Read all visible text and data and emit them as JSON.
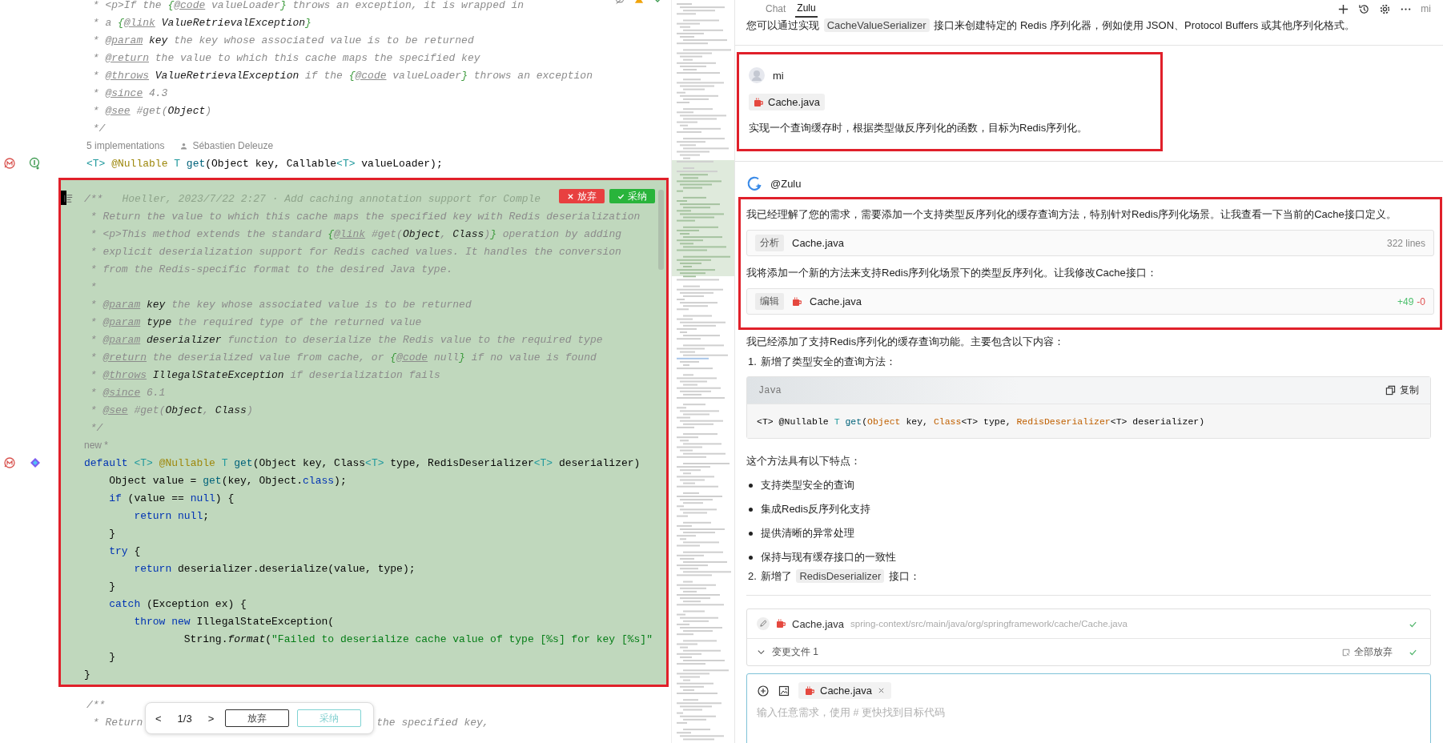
{
  "editor": {
    "top_lines": [
      {
        "kind": "code",
        "tokens": [
          {
            "kind": "comment",
            "text": " * <p>If the "
          },
          {
            "kind": "brace",
            "text": "{"
          },
          {
            "kind": "doctag",
            "text": "@code"
          },
          {
            "kind": "comment",
            "text": " valueLoader"
          },
          {
            "kind": "brace",
            "text": "}"
          },
          {
            "kind": "comment",
            "text": " throws an exception, it is wrapped in"
          }
        ]
      },
      {
        "kind": "code",
        "tokens": [
          {
            "kind": "comment",
            "text": " * a "
          },
          {
            "kind": "brace",
            "text": "{"
          },
          {
            "kind": "doctag",
            "text": "@link"
          },
          {
            "kind": "docref",
            "text": " ValueRetrievalException"
          },
          {
            "kind": "brace",
            "text": "}"
          }
        ]
      },
      {
        "kind": "code",
        "tokens": [
          {
            "kind": "comment",
            "text": " * "
          },
          {
            "kind": "doctag",
            "text": "@param"
          },
          {
            "kind": "docref",
            "text": " key"
          },
          {
            "kind": "comment",
            "text": " the key whose associated value is to be returned"
          }
        ]
      },
      {
        "kind": "code",
        "tokens": [
          {
            "kind": "comment",
            "text": " * "
          },
          {
            "kind": "doctag",
            "text": "@return"
          },
          {
            "kind": "comment",
            "text": " the value to which this cache maps the specified key"
          }
        ]
      },
      {
        "kind": "code",
        "tokens": [
          {
            "kind": "comment",
            "text": " * "
          },
          {
            "kind": "doctag",
            "text": "@throws"
          },
          {
            "kind": "docref",
            "text": " ValueRetrievalException"
          },
          {
            "kind": "comment",
            "text": " if the "
          },
          {
            "kind": "brace",
            "text": "{"
          },
          {
            "kind": "doctag",
            "text": "@code"
          },
          {
            "kind": "comment",
            "text": " valueLoader"
          },
          {
            "kind": "brace",
            "text": "}"
          },
          {
            "kind": "comment",
            "text": " throws an exception"
          }
        ]
      },
      {
        "kind": "code",
        "tokens": [
          {
            "kind": "comment",
            "text": " * "
          },
          {
            "kind": "doctag",
            "text": "@since"
          },
          {
            "kind": "comment",
            "text": " 4.3"
          }
        ]
      },
      {
        "kind": "code",
        "tokens": [
          {
            "kind": "comment",
            "text": " * "
          },
          {
            "kind": "doctag",
            "text": "@see"
          },
          {
            "kind": "comment",
            "text": " #get("
          },
          {
            "kind": "docref",
            "text": "Object"
          },
          {
            "kind": "comment",
            "text": ")"
          }
        ]
      },
      {
        "kind": "code",
        "tokens": [
          {
            "kind": "comment",
            "text": " */"
          }
        ]
      },
      {
        "kind": "hint",
        "texts": [
          "5 implementations",
          "Sébastien Deleuze"
        ]
      },
      {
        "kind": "code",
        "tokens": [
          {
            "kind": "generic",
            "text": "<T> "
          },
          {
            "kind": "annotation",
            "text": "@Nullable "
          },
          {
            "kind": "generic",
            "text": "T "
          },
          {
            "kind": "method",
            "text": "get"
          },
          {
            "kind": "plain",
            "text": "(Object key, Callable"
          },
          {
            "kind": "generic",
            "text": "<T>"
          },
          {
            "kind": "plain",
            "text": " valueLoader);"
          }
        ]
      }
    ],
    "diff_block": {
      "highlighted": true,
      "discard": "放弃",
      "accept": "采纳",
      "lines": [
        {
          "kind": "code",
          "tokens": [
            {
              "kind": "comment",
              "text": "/**"
            }
          ],
          "blame": "Hoeller, 2023/7/22 2:27 · Add caching annotation support for Comple"
        },
        {
          "kind": "code",
          "tokens": [
            {
              "kind": "comment",
              "text": " * Return the value to which this cache maps the specified key with Redis deserialization"
            }
          ]
        },
        {
          "kind": "code",
          "tokens": [
            {
              "kind": "comment",
              "text": " * <p>This method extends the standard "
            },
            {
              "kind": "brace",
              "text": "{"
            },
            {
              "kind": "doctag",
              "text": "@link"
            },
            {
              "kind": "comment",
              "text": " #get("
            },
            {
              "kind": "docref",
              "text": "Object"
            },
            {
              "kind": "comment",
              "text": ", "
            },
            {
              "kind": "docref",
              "text": "Class"
            },
            {
              "kind": "comment",
              "text": ")"
            },
            {
              "kind": "brace",
              "text": "}"
            },
            {
              "kind": "comment",
              "text": " operation by adding"
            }
          ]
        },
        {
          "kind": "code",
          "tokens": [
            {
              "kind": "comment",
              "text": " * explicit deserialization support for Redis cached values. It handles the conversion"
            }
          ]
        },
        {
          "kind": "code",
          "tokens": [
            {
              "kind": "comment",
              "text": " * from the Redis-specific format to the desired Java type."
            }
          ]
        },
        {
          "kind": "code",
          "tokens": [
            {
              "kind": "comment",
              "text": " *"
            }
          ]
        },
        {
          "kind": "code",
          "tokens": [
            {
              "kind": "comment",
              "text": " * "
            },
            {
              "kind": "doctag",
              "text": "@param"
            },
            {
              "kind": "docref",
              "text": " key"
            },
            {
              "kind": "comment",
              "text": " the key whose associated value is to be returned"
            }
          ]
        },
        {
          "kind": "code",
          "tokens": [
            {
              "kind": "comment",
              "text": " * "
            },
            {
              "kind": "doctag",
              "text": "@param"
            },
            {
              "kind": "docref",
              "text": " type"
            },
            {
              "kind": "comment",
              "text": " the required type of the returned value"
            }
          ]
        },
        {
          "kind": "code",
          "tokens": [
            {
              "kind": "comment",
              "text": " * "
            },
            {
              "kind": "doctag",
              "text": "@param"
            },
            {
              "kind": "docref",
              "text": " deserializer"
            },
            {
              "kind": "comment",
              "text": " function to deserialize the Redis value to the required type"
            }
          ]
        },
        {
          "kind": "code",
          "tokens": [
            {
              "kind": "comment",
              "text": " * "
            },
            {
              "kind": "doctag",
              "text": "@return"
            },
            {
              "kind": "comment",
              "text": " the deserialized value from cache, or "
            },
            {
              "kind": "brace",
              "text": "{"
            },
            {
              "kind": "doctag",
              "text": "@code"
            },
            {
              "kind": "comment",
              "text": " null"
            },
            {
              "kind": "brace",
              "text": "}"
            },
            {
              "kind": "comment",
              "text": " if no value is found"
            }
          ]
        },
        {
          "kind": "code",
          "tokens": [
            {
              "kind": "comment",
              "text": " * "
            },
            {
              "kind": "doctag",
              "text": "@throws"
            },
            {
              "kind": "docref",
              "text": " IllegalStateException"
            },
            {
              "kind": "comment",
              "text": " if deserialization fails"
            }
          ]
        },
        {
          "kind": "code",
          "tokens": [
            {
              "kind": "comment",
              "text": " * "
            },
            {
              "kind": "doctag",
              "text": "@since"
            },
            {
              "kind": "comment",
              "text": " 6.1"
            }
          ]
        },
        {
          "kind": "code",
          "tokens": [
            {
              "kind": "comment",
              "text": " * "
            },
            {
              "kind": "doctag",
              "text": "@see"
            },
            {
              "kind": "comment",
              "text": " #get("
            },
            {
              "kind": "docref",
              "text": "Object"
            },
            {
              "kind": "comment",
              "text": ", "
            },
            {
              "kind": "docref",
              "text": "Class"
            },
            {
              "kind": "comment",
              "text": ")"
            }
          ]
        },
        {
          "kind": "code",
          "tokens": [
            {
              "kind": "comment",
              "text": " */"
            }
          ]
        },
        {
          "kind": "hint",
          "texts": [
            "new *"
          ]
        },
        {
          "kind": "code",
          "tokens": [
            {
              "kind": "keyword",
              "text": "default "
            },
            {
              "kind": "generic",
              "text": "<T> "
            },
            {
              "kind": "annotation",
              "text": "@Nullable "
            },
            {
              "kind": "generic",
              "text": "T "
            },
            {
              "kind": "method",
              "text": "get"
            },
            {
              "kind": "plain",
              "text": "(Object key, Class"
            },
            {
              "kind": "generic",
              "text": "<T>"
            },
            {
              "kind": "plain",
              "text": " type, RedisDeserializer"
            },
            {
              "kind": "generic",
              "text": "<T>"
            },
            {
              "kind": "plain",
              "text": " deserializer)"
            }
          ]
        },
        {
          "kind": "code",
          "tokens": [
            {
              "kind": "plain",
              "text": "    Object value = "
            },
            {
              "kind": "method",
              "text": "get"
            },
            {
              "kind": "plain",
              "text": "(key, Object."
            },
            {
              "kind": "keyword",
              "text": "class"
            },
            {
              "kind": "plain",
              "text": ");"
            }
          ]
        },
        {
          "kind": "code",
          "tokens": [
            {
              "kind": "keyword",
              "text": "    if "
            },
            {
              "kind": "plain",
              "text": "(value == "
            },
            {
              "kind": "keyword",
              "text": "null"
            },
            {
              "kind": "plain",
              "text": ") {"
            }
          ]
        },
        {
          "kind": "code",
          "tokens": [
            {
              "kind": "keyword",
              "text": "        return null"
            },
            {
              "kind": "plain",
              "text": ";"
            }
          ]
        },
        {
          "kind": "code",
          "tokens": [
            {
              "kind": "plain",
              "text": "    }"
            }
          ]
        },
        {
          "kind": "code",
          "tokens": [
            {
              "kind": "keyword",
              "text": "    try "
            },
            {
              "kind": "plain",
              "text": "{"
            }
          ]
        },
        {
          "kind": "code",
          "tokens": [
            {
              "kind": "keyword",
              "text": "        return "
            },
            {
              "kind": "plain",
              "text": "deserializer.deserialize(value, type);"
            }
          ]
        },
        {
          "kind": "code",
          "tokens": [
            {
              "kind": "plain",
              "text": "    }"
            }
          ]
        },
        {
          "kind": "code",
          "tokens": [
            {
              "kind": "keyword",
              "text": "    catch "
            },
            {
              "kind": "plain",
              "text": "(Exception ex) {"
            }
          ]
        },
        {
          "kind": "code",
          "tokens": [
            {
              "kind": "keyword",
              "text": "        throw new "
            },
            {
              "kind": "plain",
              "text": "IllegalStateException("
            }
          ]
        },
        {
          "kind": "code",
          "tokens": [
            {
              "kind": "plain",
              "text": "                String."
            },
            {
              "kind": "italic",
              "text": "format"
            },
            {
              "kind": "plain",
              "text": "("
            },
            {
              "kind": "string",
              "text": "\"Failed to deserialize cache value of type [%s] for key [%s]\""
            }
          ]
        },
        {
          "kind": "code",
          "tokens": [
            {
              "kind": "plain",
              "text": "    }"
            }
          ]
        },
        {
          "kind": "code",
          "tokens": [
            {
              "kind": "plain",
              "text": "}"
            }
          ]
        }
      ]
    },
    "bottom_lines": [
      {
        "kind": "code",
        "tokens": [
          {
            "kind": "comment",
            "text": "/**"
          }
        ]
      },
      {
        "kind": "code",
        "tokens": [
          {
            "kind": "comment",
            "text": " * Return"
          }
        ],
        "after_overlay": [
          {
            "kind": "comment",
            "text": "the specified key,"
          }
        ]
      }
    ],
    "review_bar": {
      "prev": "<",
      "position": "1/3",
      "next": ">",
      "discard": "放弃",
      "accept": "采纳"
    }
  },
  "chat": {
    "tabs": [
      {
        "label": "Chat",
        "selected": false
      },
      {
        "label": "Zulu",
        "selected": true
      }
    ],
    "header_user": "mi",
    "intro": [
      {
        "kind": "text",
        "text": "您可以通过实现 "
      },
      {
        "kind": "code",
        "text": "CacheValueSerializer"
      },
      {
        "kind": "text",
        "text": " 接口来创建特定的 Redis 序列化器，例如使用 JSON、Protocol Buffers 或其他序列化格式。"
      }
    ],
    "user_message": {
      "highlighted": true,
      "author": "mi",
      "attachment": "Cache.java",
      "text": "实现一个查询缓存时，根据类型做反序列化的函数，目标为Redis序列化。"
    },
    "reply": {
      "author": "@Zulu",
      "highlighted": true,
      "steps": [
        {
          "kind": "text",
          "text": "我已经理解了您的需求，需要添加一个支持类型反序列化的缓存查询方法，特别针对Redis序列化场景。让我查看一下当前的Cache接口定义。"
        },
        {
          "kind": "tool",
          "action": "分析",
          "file": "Cache.java",
          "file_icon": false,
          "meta": "322 lines"
        },
        {
          "kind": "text",
          "text": "我将添加一个新的方法来支持Redis序列化场景下的类型反序列化。让我修改Cache接口："
        },
        {
          "kind": "tool",
          "action": "编辑",
          "file": "Cache.java",
          "file_icon": true,
          "added": "+49",
          "removed": "-0"
        }
      ]
    },
    "content": [
      {
        "kind": "paragraph",
        "text": "我已经添加了支持Redis序列化的缓存查询功能。主要包含以下内容："
      },
      {
        "kind": "numbered",
        "number": "1.",
        "parts": [
          {
            "kind": "text",
            "text": "新增了类型安全的查询方法："
          }
        ]
      },
      {
        "kind": "code_block",
        "language": "Java",
        "copy": "复制",
        "tokens": [
          {
            "kind": "plain",
            "text": "<T> @Nullable "
          },
          {
            "kind": "generic",
            "text": "T "
          },
          {
            "kind": "method",
            "text": "get"
          },
          {
            "kind": "plain",
            "text": "("
          },
          {
            "kind": "type",
            "text": "Object"
          },
          {
            "kind": "plain",
            "text": " key, "
          },
          {
            "kind": "type",
            "text": "Class"
          },
          {
            "kind": "plain",
            "text": "<T> type, "
          },
          {
            "kind": "type",
            "text": "RedisDeserializer"
          },
          {
            "kind": "plain",
            "text": "<T> deserializer)"
          }
        ]
      },
      {
        "kind": "paragraph",
        "text": "这个方法具有以下特点："
      },
      {
        "kind": "bullet",
        "text": "支持类型安全的查询"
      },
      {
        "kind": "bullet",
        "text": "集成Redis反序列化支持"
      },
      {
        "kind": "bullet",
        "text": "提供清晰的异常处理"
      },
      {
        "kind": "bullet",
        "text": "保持与现有缓存接口的一致性"
      },
      {
        "kind": "numbered",
        "number": "2.",
        "parts": [
          {
            "kind": "text",
            "text": "新增了 "
          },
          {
            "kind": "code",
            "text": "RedisDeserializer"
          },
          {
            "kind": "text",
            "text": " 接口："
          }
        ]
      }
    ],
    "change_card": {
      "file": "Cache.java",
      "path": "spring-context/src/main/java/org/springframework/cache/Cache.java",
      "done": true,
      "changes": "变更文件 1",
      "discard_all": "全部放弃",
      "changes_done": true
    },
    "input": {
      "attachment": "Cache.java",
      "placeholder": "输入任意需求，使用 # 更快找到目标代码"
    }
  }
}
